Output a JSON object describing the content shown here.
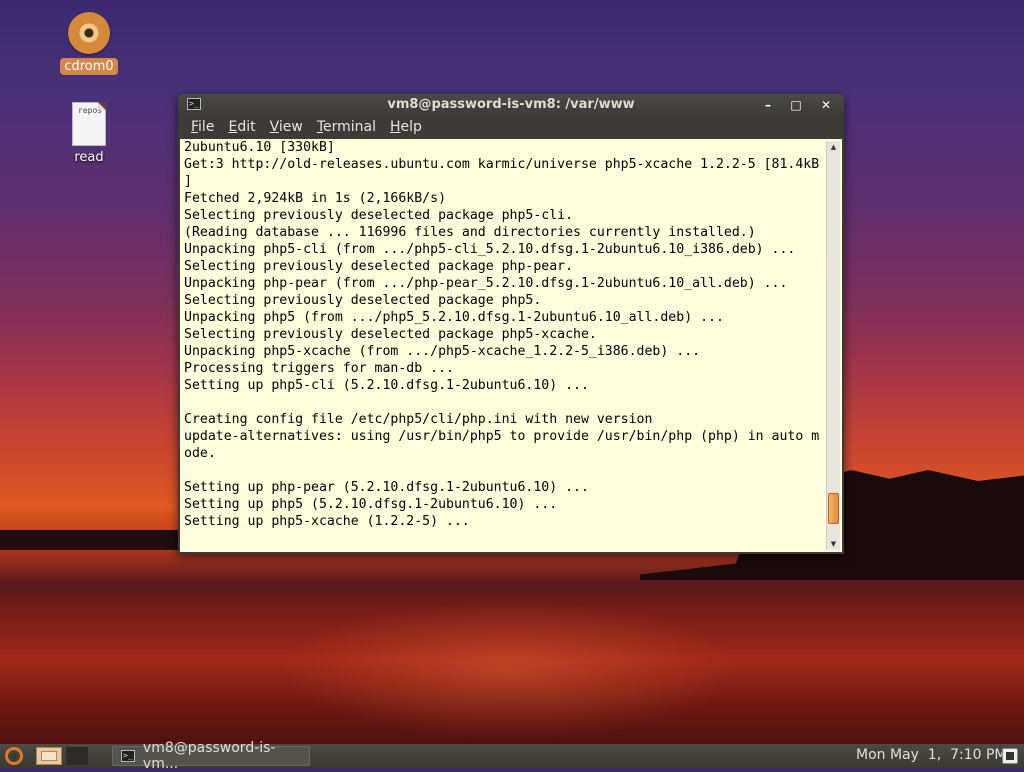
{
  "desktop": {
    "icons": [
      {
        "label": "cdrom0"
      },
      {
        "label": "read",
        "file_text": "repos"
      }
    ]
  },
  "window": {
    "title": "vm8@password-is-vm8: /var/www",
    "buttons": {
      "minimize": "–",
      "maximize": "□",
      "close": "✕"
    },
    "menu": [
      {
        "label": "File",
        "accel": "F",
        "rest": "ile"
      },
      {
        "label": "Edit",
        "accel": "E",
        "rest": "dit"
      },
      {
        "label": "View",
        "accel": "V",
        "rest": "iew"
      },
      {
        "label": "Terminal",
        "accel": "T",
        "rest": "erminal"
      },
      {
        "label": "Help",
        "accel": "H",
        "rest": "elp"
      }
    ],
    "terminal_text": "2ubuntu6.10 [330kB]\nGet:3 http://old-releases.ubuntu.com karmic/universe php5-xcache 1.2.2-5 [81.4kB\n]\nFetched 2,924kB in 1s (2,166kB/s)\nSelecting previously deselected package php5-cli.\n(Reading database ... 116996 files and directories currently installed.)\nUnpacking php5-cli (from .../php5-cli_5.2.10.dfsg.1-2ubuntu6.10_i386.deb) ...\nSelecting previously deselected package php-pear.\nUnpacking php-pear (from .../php-pear_5.2.10.dfsg.1-2ubuntu6.10_all.deb) ...\nSelecting previously deselected package php5.\nUnpacking php5 (from .../php5_5.2.10.dfsg.1-2ubuntu6.10_all.deb) ...\nSelecting previously deselected package php5-xcache.\nUnpacking php5-xcache (from .../php5-xcache_1.2.2-5_i386.deb) ...\nProcessing triggers for man-db ...\nSetting up php5-cli (5.2.10.dfsg.1-2ubuntu6.10) ...\n\nCreating config file /etc/php5/cli/php.ini with new version\nupdate-alternatives: using /usr/bin/php5 to provide /usr/bin/php (php) in auto m\node.\n\nSetting up php-pear (5.2.10.dfsg.1-2ubuntu6.10) ...\nSetting up php5 (5.2.10.dfsg.1-2ubuntu6.10) ...\nSetting up php5-xcache (1.2.2-5) ...",
    "scroll": {
      "position_fraction": 0.96,
      "visible_fraction": 0.08
    }
  },
  "panel": {
    "task_label": "vm8@password-is-vm...",
    "clock": "Mon May  1,  7:10 PM"
  },
  "colors": {
    "terminal_bg": "#ffffdd",
    "terminal_fg": "#000000",
    "accent": "#e07a2a",
    "window_chrome": "#3c3b37"
  }
}
